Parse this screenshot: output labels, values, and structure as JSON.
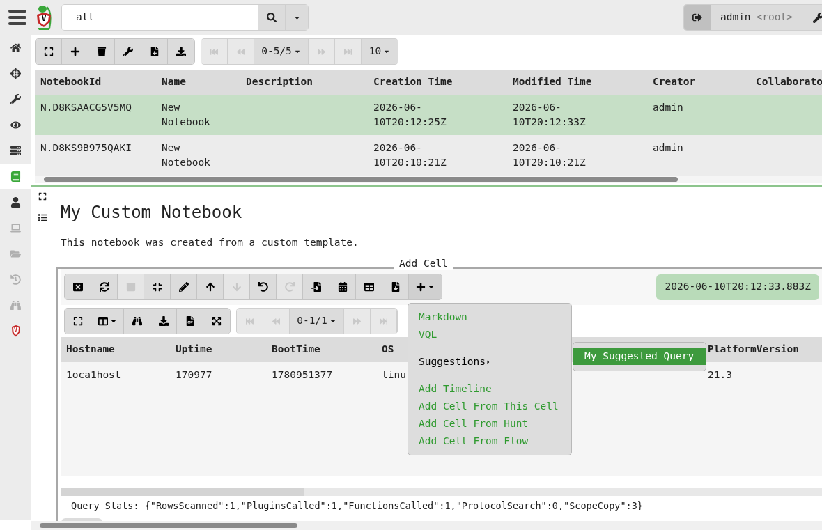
{
  "logo": {
    "letter": "V"
  },
  "search": {
    "value": "all"
  },
  "user": {
    "name": "admin",
    "role": "<root>"
  },
  "sidebar": {
    "items": [
      {
        "kind": "home",
        "selected": false,
        "disabled": false
      },
      {
        "kind": "crosshairs",
        "selected": false,
        "disabled": false
      },
      {
        "kind": "wrench",
        "selected": false,
        "disabled": false
      },
      {
        "kind": "eye",
        "selected": false,
        "disabled": false
      },
      {
        "kind": "server",
        "selected": false,
        "disabled": false
      },
      {
        "kind": "book",
        "selected": true,
        "disabled": false
      },
      {
        "kind": "user",
        "selected": false,
        "disabled": false
      },
      {
        "kind": "laptop",
        "selected": false,
        "disabled": true
      },
      {
        "kind": "folder",
        "selected": false,
        "disabled": true
      },
      {
        "kind": "history",
        "selected": false,
        "disabled": true
      },
      {
        "kind": "binoculars",
        "selected": false,
        "disabled": true
      },
      {
        "kind": "shield",
        "selected": false,
        "disabled": false,
        "letter": "V"
      }
    ]
  },
  "notebooks_toolbar": {
    "buttons": [
      {
        "kind": "expand",
        "disabled": false
      },
      {
        "kind": "plus",
        "disabled": false
      },
      {
        "kind": "trash",
        "disabled": false
      },
      {
        "kind": "wrench",
        "disabled": false
      },
      {
        "kind": "file-download",
        "disabled": false
      },
      {
        "kind": "download",
        "disabled": false
      }
    ],
    "pager": {
      "first_disabled": true,
      "prev_disabled": true,
      "range": "0-5/5",
      "next_disabled": true,
      "last_disabled": true,
      "page_size": "10"
    }
  },
  "notebooks_table": {
    "columns": [
      "NotebookId",
      "Name",
      "Description",
      "Creation Time",
      "Modified Time",
      "Creator",
      "Collaborato"
    ],
    "rows": [
      {
        "selected": true,
        "cells": [
          "N.D8KSAACG5V5MQ",
          "New Notebook",
          "",
          "2026-06-10T20:12:25Z",
          "2026-06-10T20:12:33Z",
          "admin",
          ""
        ]
      },
      {
        "selected": false,
        "cells": [
          "N.D8KS9B975QAKI",
          "New Notebook",
          "",
          "2026-06-10T20:10:21Z",
          "2026-06-10T20:10:21Z",
          "admin",
          ""
        ]
      }
    ]
  },
  "notebook": {
    "title": "My Custom Notebook",
    "description": "This notebook was created from a custom template.",
    "add_cell_label": "Add Cell",
    "cell": {
      "toolbar": [
        {
          "kind": "close",
          "disabled": false
        },
        {
          "kind": "sync",
          "disabled": false
        },
        {
          "kind": "stop",
          "disabled": true
        },
        {
          "kind": "compress",
          "disabled": false
        },
        {
          "kind": "pencil",
          "disabled": false
        },
        {
          "kind": "up",
          "disabled": false
        },
        {
          "kind": "down",
          "disabled": true
        },
        {
          "kind": "undo",
          "disabled": false
        },
        {
          "kind": "redo",
          "disabled": true
        },
        {
          "kind": "import",
          "disabled": false
        },
        {
          "kind": "calendar",
          "disabled": false
        },
        {
          "kind": "table",
          "disabled": false
        },
        {
          "kind": "file-download",
          "disabled": false
        },
        {
          "kind": "add",
          "disabled": false,
          "expanded": true
        }
      ],
      "timestamp": "2026-06-10T20:12:33.883Z",
      "results_toolbar": [
        {
          "kind": "expand",
          "disabled": false
        },
        {
          "kind": "columns",
          "disabled": false
        },
        {
          "kind": "binoculars",
          "disabled": false
        },
        {
          "kind": "download",
          "disabled": false
        },
        {
          "kind": "csv",
          "disabled": false
        },
        {
          "kind": "fullscreen",
          "disabled": false
        }
      ],
      "pager": {
        "first_disabled": true,
        "prev_disabled": true,
        "range": "0-1/1",
        "next_disabled": true,
        "last_disabled": true
      },
      "table": {
        "columns": [
          "Hostname",
          "Uptime",
          "BootTime",
          "OS",
          "PlatformVersion"
        ],
        "rows": [
          {
            "cells": [
              "1oca1host",
              "170977",
              "1780951377",
              "linu",
              "21.3"
            ]
          }
        ]
      },
      "query_stats": "Query Stats: {\"RowsScanned\":1,\"PluginsCalled\":1,\"FunctionsCalled\":1,\"ProtocolSearch\":0,\"ScopeCopy\":3}",
      "menu": {
        "items": [
          {
            "kind": "item",
            "label": "Markdown"
          },
          {
            "kind": "item",
            "label": "VQL"
          },
          {
            "kind": "submenu",
            "label": "Suggestions",
            "expanded": true,
            "items": [
              {
                "label": "My Suggested Query",
                "selected": true
              }
            ]
          },
          {
            "kind": "item",
            "label": "Add Timeline"
          },
          {
            "kind": "item",
            "label": "Add Cell From This Cell"
          },
          {
            "kind": "item",
            "label": "Add Cell From Hunt"
          },
          {
            "kind": "item",
            "label": "Add Cell From Flow"
          }
        ]
      }
    }
  }
}
